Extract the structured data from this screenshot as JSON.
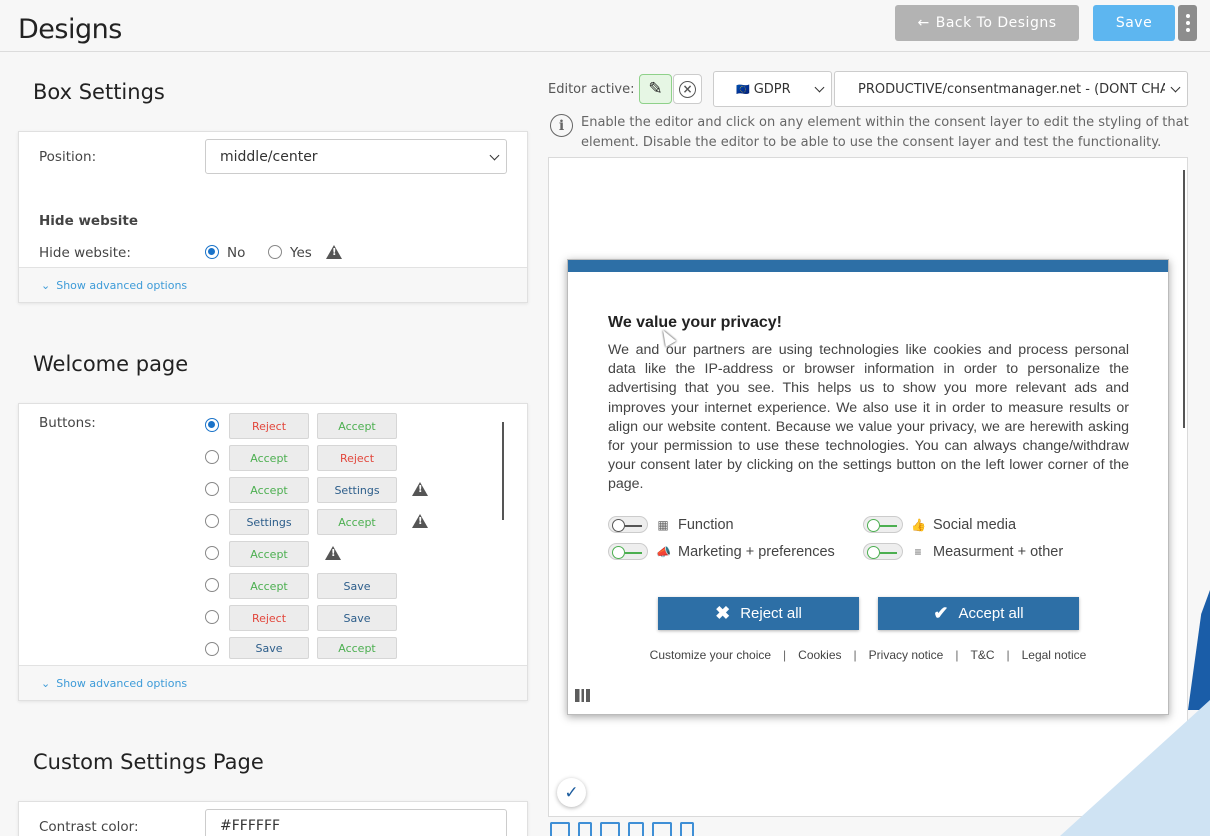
{
  "header": {
    "title": "Designs",
    "back_label": "Back To Designs",
    "save_label": "Save"
  },
  "box_settings": {
    "title": "Box Settings",
    "position_label": "Position:",
    "position_value": "middle/center",
    "hide_website_heading": "Hide website",
    "hide_website_label": "Hide website:",
    "options": [
      "No",
      "Yes"
    ],
    "selected": "No",
    "advanced": "Show advanced options"
  },
  "welcome_page": {
    "title": "Welcome page",
    "buttons_label": "Buttons:",
    "rows": [
      {
        "a": "Reject",
        "b": "Accept",
        "warn": false,
        "selected": true
      },
      {
        "a": "Accept",
        "b": "Reject",
        "warn": false,
        "selected": false
      },
      {
        "a": "Accept",
        "b": "Settings",
        "warn": true,
        "selected": false
      },
      {
        "a": "Settings",
        "b": "Accept",
        "warn": true,
        "selected": false
      },
      {
        "a": "Accept",
        "b": "",
        "warn": true,
        "selected": false
      },
      {
        "a": "Accept",
        "b": "Save",
        "warn": false,
        "selected": false
      },
      {
        "a": "Reject",
        "b": "Save",
        "warn": false,
        "selected": false
      },
      {
        "a": "Save",
        "b": "Accept",
        "warn": false,
        "selected": false
      }
    ],
    "advanced": "Show advanced options"
  },
  "custom_settings": {
    "title": "Custom Settings Page",
    "contrast_label": "Contrast color:",
    "contrast_value": "#FFFFFF"
  },
  "editor": {
    "label": "Editor active:",
    "law_select": "GDPR",
    "law_flag": "🇪🇺",
    "domain_select": "PRODUCTIVE/consentmanager.net - (DONT CHAN",
    "info": "Enable the editor and click on any element within the consent layer to edit the styling of that element. Disable the editor to be able to use the consent layer and test the functionality."
  },
  "consent": {
    "title": "We value your privacy!",
    "body": "We and our partners are using technologies like cookies and process personal data like the IP-address or browser information in order to personalize the advertising that you see. This helps us to show you more relevant ads and improves your internet experience. We also use it in order to measure results or align our website content. Because we value your privacy, we are herewith asking for your permission to use these technologies. You can always change/withdraw your consent later by clicking on the settings button on the left lower corner of the page.",
    "purposes": [
      "Function",
      "Social media",
      "Marketing + preferences",
      "Measurment + other"
    ],
    "reject_all": "Reject all",
    "accept_all": "Accept all",
    "links": [
      "Customize your choice",
      "Cookies",
      "Privacy notice",
      "T&C",
      "Legal notice"
    ],
    "link_separator": "|"
  },
  "colors": {
    "accent": "#2d6fa6",
    "save": "#5db6f0",
    "back": "#b3b3b3",
    "reject_text": "#e2463b",
    "accept_text": "#4caf50"
  }
}
